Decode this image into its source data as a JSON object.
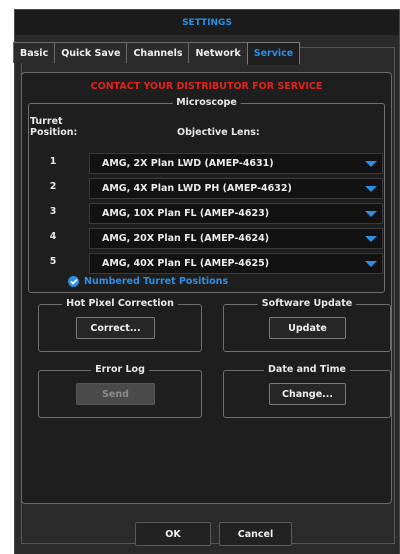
{
  "window": {
    "title": "SETTINGS"
  },
  "tabs": [
    {
      "label": "Basic",
      "active": false
    },
    {
      "label": "Quick Save",
      "active": false
    },
    {
      "label": "Channels",
      "active": false
    },
    {
      "label": "Network",
      "active": false
    },
    {
      "label": "Service",
      "active": true
    }
  ],
  "service": {
    "warning": "CONTACT YOUR DISTRIBUTOR FOR SERVICE",
    "microscope": {
      "legend": "Microscope",
      "turret_header_line1": "Turret",
      "turret_header_line2": "Position:",
      "objective_header": "Objective Lens:",
      "rows": [
        {
          "position": "1",
          "lens": "AMG, 2X Plan LWD (AMEP-4631)"
        },
        {
          "position": "2",
          "lens": "AMG, 4X Plan LWD PH (AMEP-4632)"
        },
        {
          "position": "3",
          "lens": "AMG, 10X Plan FL (AMEP-4623)"
        },
        {
          "position": "4",
          "lens": "AMG, 20X Plan FL (AMEP-4624)"
        },
        {
          "position": "5",
          "lens": "AMG, 40X Plan FL (AMEP-4625)"
        }
      ],
      "numbered_turret": {
        "label": "Numbered Turret Positions",
        "checked": true
      }
    },
    "hot_pixel": {
      "legend": "Hot Pixel Correction",
      "button": "Correct..."
    },
    "software_update": {
      "legend": "Software Update",
      "button": "Update"
    },
    "error_log": {
      "legend": "Error Log",
      "button": "Send",
      "enabled": false
    },
    "date_time": {
      "legend": "Date and Time",
      "button": "Change..."
    }
  },
  "dialog_buttons": {
    "ok": "OK",
    "cancel": "Cancel"
  },
  "colors": {
    "accent": "#2d8ee6",
    "warning": "#e0231d",
    "background": "#2a2a2a",
    "panel": "#1e1e1e"
  }
}
